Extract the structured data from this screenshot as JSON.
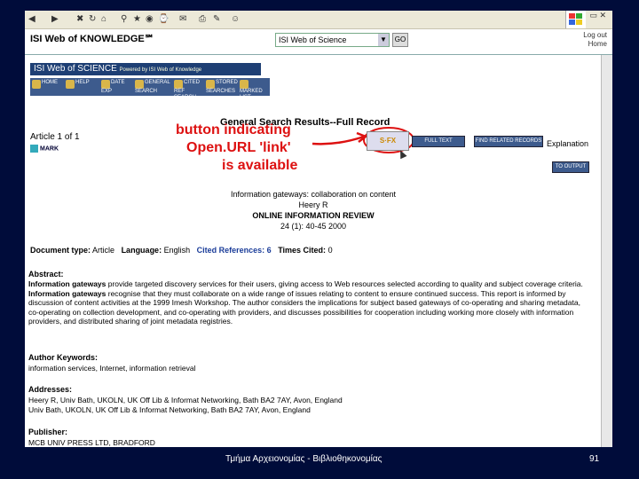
{
  "browser": {
    "isi_title": "ISI Web of KNOWLEDGE℠",
    "database_select": "ISI Web of Science",
    "go_label": "GO",
    "logout_label": "Log out",
    "home_label": "Home"
  },
  "banner": {
    "sos": "ISI Web of SCIENCE",
    "sos_sub": "Powered by ISI Web of Knowledge"
  },
  "nav": {
    "items": [
      "HOME",
      "HELP",
      "DATE EXP",
      "GENERAL SEARCH",
      "CITED REF SEARCH",
      "STORED SEARCHES",
      "MARKED LIST"
    ]
  },
  "page": {
    "title": "General Search Results--Full Record",
    "article_of": "Article 1 of 1",
    "mark_label": "MARK"
  },
  "annotation": {
    "line1": "button indicating",
    "line2": "Open.URL 'link'",
    "line3": "is available"
  },
  "buttons": {
    "sfx": "S·FX",
    "btn1": "FULL TEXT",
    "btn2": "FIND RELATED RECORDS",
    "explanation": "Explanation",
    "btn3": "TO OUTPUT"
  },
  "record": {
    "title_partial": "Information gateways: collaboration on content",
    "author": "Heery R",
    "journal": "ONLINE INFORMATION REVIEW",
    "volume": "24 (1): 40-45 2000",
    "doc_type_label": "Document type:",
    "doc_type": "Article",
    "language_label": "Language:",
    "language": "English",
    "cited_refs": "Cited References: 6",
    "times_cited_label": "Times Cited:",
    "times_cited": "0"
  },
  "abstract": {
    "heading": "Abstract:",
    "text_bold1": "Information gateways",
    "text1": " provide targeted discovery services for their users, giving access to Web resources selected according to quality and subject coverage criteria. ",
    "text_bold2": "Information gateways",
    "text2": " recognise that they must collaborate on a wide range of issues relating to content to ensure continued success. This report is informed by discussion of content activities at the 1999 Imesh Workshop. The author considers the implications for subject based gateways of co-operating and sharing metadata, co-operating on collection development, and co-operating with providers, and discusses possibilities for cooperation including working more closely with information providers, and distributed sharing of joint metadata registries."
  },
  "keywords": {
    "heading": "Author Keywords:",
    "text": "information services, Internet, information retrieval"
  },
  "addresses": {
    "heading": "Addresses:",
    "line1": "Heery R, Univ Bath, UKOLN, UK Off Lib & Informat Networking, Bath BA2 7AY, Avon, England",
    "line2": "Univ Bath, UKOLN, UK Off Lib & Informat Networking, Bath BA2 7AY, Avon, England"
  },
  "publisher": {
    "heading": "Publisher:",
    "text": "MCB UNIV PRESS LTD, BRADFORD"
  },
  "footer": {
    "text": "Τμήμα Αρχειονομίας - Βιβλιοθηκονομίας",
    "page": "91"
  },
  "colors": {
    "slide_bg": "#000c3a",
    "nav_blue": "#3d5b8d",
    "annotation_red": "#dd1111"
  }
}
